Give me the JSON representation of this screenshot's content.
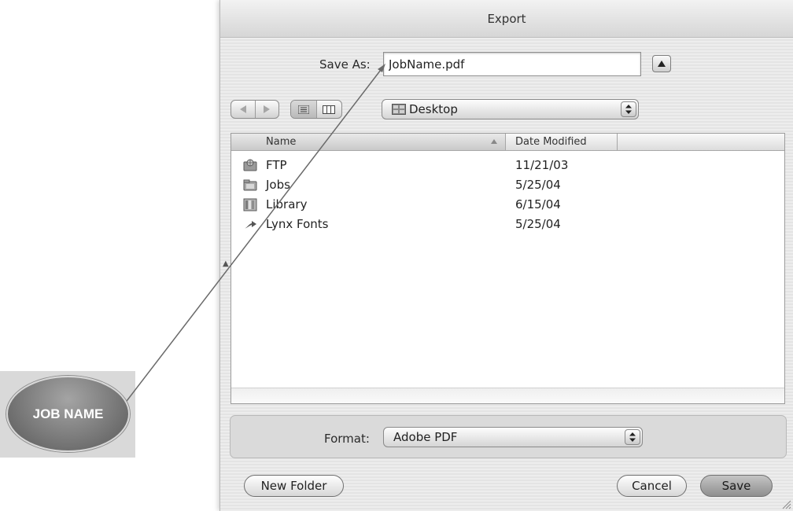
{
  "dialog": {
    "title": "Export",
    "save_as_label": "Save As:",
    "save_as_value": "JobName.pdf"
  },
  "toolbar": {
    "location": "Desktop"
  },
  "browser": {
    "columns": {
      "name": "Name",
      "date": "Date Modified"
    },
    "files": [
      {
        "name": "FTP",
        "date": "11/21/03",
        "icon": "ftp-folder-icon"
      },
      {
        "name": "Jobs",
        "date": "5/25/04",
        "icon": "jobs-folder-icon"
      },
      {
        "name": "Library",
        "date": "6/15/04",
        "icon": "library-folder-icon"
      },
      {
        "name": "Lynx Fonts",
        "date": "5/25/04",
        "icon": "alias-icon"
      }
    ]
  },
  "format": {
    "label": "Format:",
    "value": "Adobe PDF"
  },
  "buttons": {
    "new_folder": "New Folder",
    "cancel": "Cancel",
    "save": "Save"
  },
  "callout": {
    "label": "JOB NAME"
  }
}
